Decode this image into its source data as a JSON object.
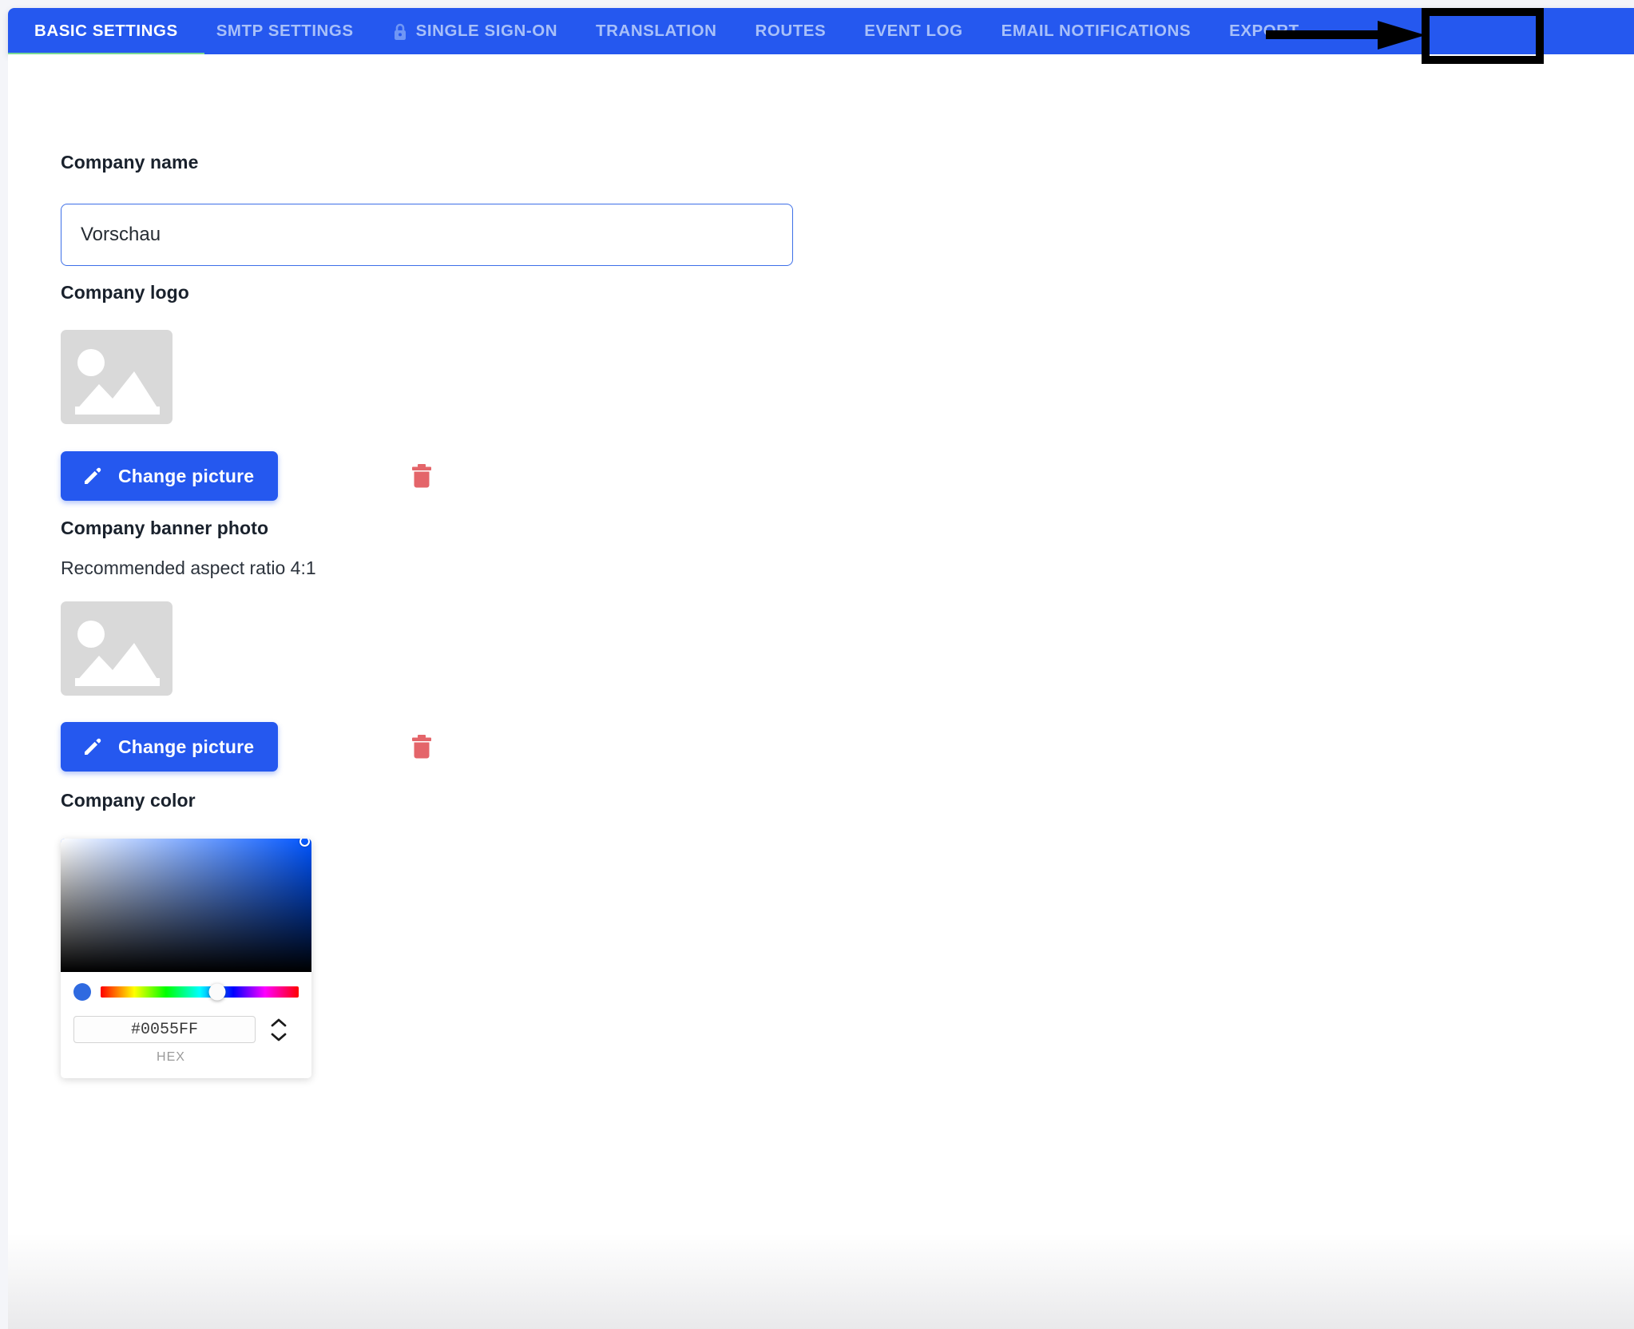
{
  "nav": {
    "tabs": [
      {
        "label": "BASIC SETTINGS",
        "active": true,
        "icon": null
      },
      {
        "label": "SMTP SETTINGS",
        "active": false,
        "icon": null
      },
      {
        "label": "SINGLE SIGN-ON",
        "active": false,
        "icon": "lock-icon"
      },
      {
        "label": "TRANSLATION",
        "active": false,
        "icon": null
      },
      {
        "label": "ROUTES",
        "active": false,
        "icon": null
      },
      {
        "label": "EVENT LOG",
        "active": false,
        "icon": null
      },
      {
        "label": "EMAIL NOTIFICATIONS",
        "active": false,
        "icon": null
      },
      {
        "label": "EXPORT",
        "active": false,
        "icon": null
      }
    ],
    "active_underline_color": "#79D894",
    "bar_color": "#2558EF",
    "active_tab_text_color": "#FFFFFF",
    "inactive_tab_text_color": "#A8C0F9"
  },
  "form": {
    "company_name": {
      "label": "Company name",
      "value": "Vorschau",
      "placeholder": "Company name"
    },
    "company_logo": {
      "label": "Company logo",
      "change_button": "Change picture",
      "placeholder_icon": "image-placeholder-icon",
      "delete_icon": "trash-icon"
    },
    "company_banner": {
      "label": "Company banner photo",
      "hint": "Recommended aspect ratio 4:1",
      "change_button": "Change picture",
      "placeholder_icon": "image-placeholder-icon",
      "delete_icon": "trash-icon"
    },
    "company_color": {
      "label": "Company color",
      "hex_value": "#0055FF",
      "hex_caption": "HEX",
      "swatch_color": "#2F6AE0",
      "selected_color": "#0055FF"
    }
  },
  "annotation": {
    "arrow_target": "EXPORT",
    "color": "#000000"
  }
}
